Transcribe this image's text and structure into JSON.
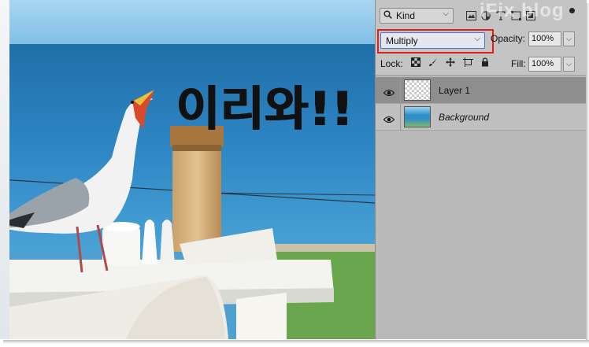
{
  "canvas": {
    "overlay_text": "이리와!!"
  },
  "layers_panel": {
    "filter": {
      "icon": "search-icon",
      "label": "Kind",
      "chevron": "⌵"
    },
    "filter_icons": [
      "image-filter-icon",
      "adjustment-filter-icon",
      "type-filter-icon",
      "shape-filter-icon",
      "smart-object-filter-icon"
    ],
    "watermark": "iFix blog",
    "blend_mode": {
      "value": "Multiply",
      "chevron": "⌵"
    },
    "opacity": {
      "label": "Opacity:",
      "value": "100%",
      "chevron": "⌵"
    },
    "lock": {
      "label": "Lock:",
      "icons": [
        "lock-transparent-pixels-icon",
        "lock-image-pixels-icon",
        "lock-position-icon",
        "lock-artboard-icon",
        "lock-all-icon"
      ]
    },
    "fill": {
      "label": "Fill:",
      "value": "100%",
      "chevron": "⌵"
    },
    "layers": [
      {
        "name": "Layer 1",
        "visible": true,
        "selected": true,
        "thumbnail": "transparent"
      },
      {
        "name": "Background",
        "visible": true,
        "selected": false,
        "thumbnail": "photo"
      }
    ]
  },
  "colors": {
    "panel_bg": "#b9b9b9",
    "selected_layer": "#8e8e8e",
    "highlight_box": "#e0201b",
    "focus_border": "#3d7bd6"
  }
}
